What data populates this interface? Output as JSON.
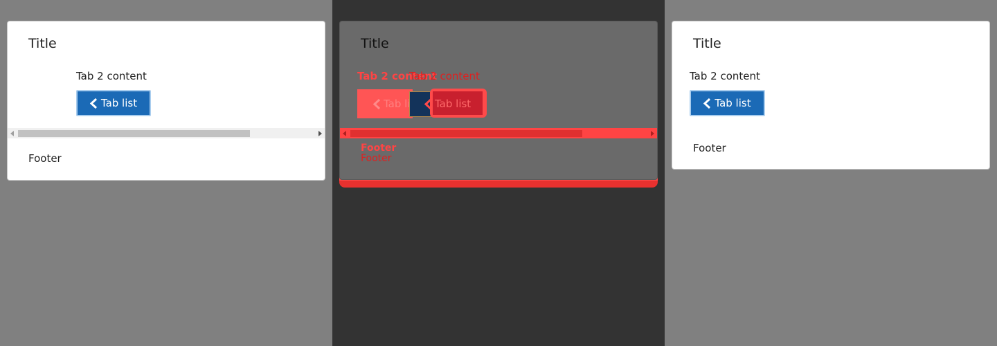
{
  "left": {
    "title": "Title",
    "tab_content": "Tab 2 content",
    "button_label": "Tab list",
    "footer": "Footer"
  },
  "middle": {
    "title": "Title",
    "tab_content": "Tab 2 content",
    "button_label": "Tab list",
    "footer": "Footer"
  },
  "right": {
    "title": "Title",
    "tab_content": "Tab 2 content",
    "button_label": "Tab list",
    "footer": "Footer"
  },
  "colors": {
    "button_bg": "#1b6ab6",
    "diff_red": "#ff4444",
    "backdrop": "#808080"
  },
  "icons": {
    "back": "chevron-left-icon"
  }
}
